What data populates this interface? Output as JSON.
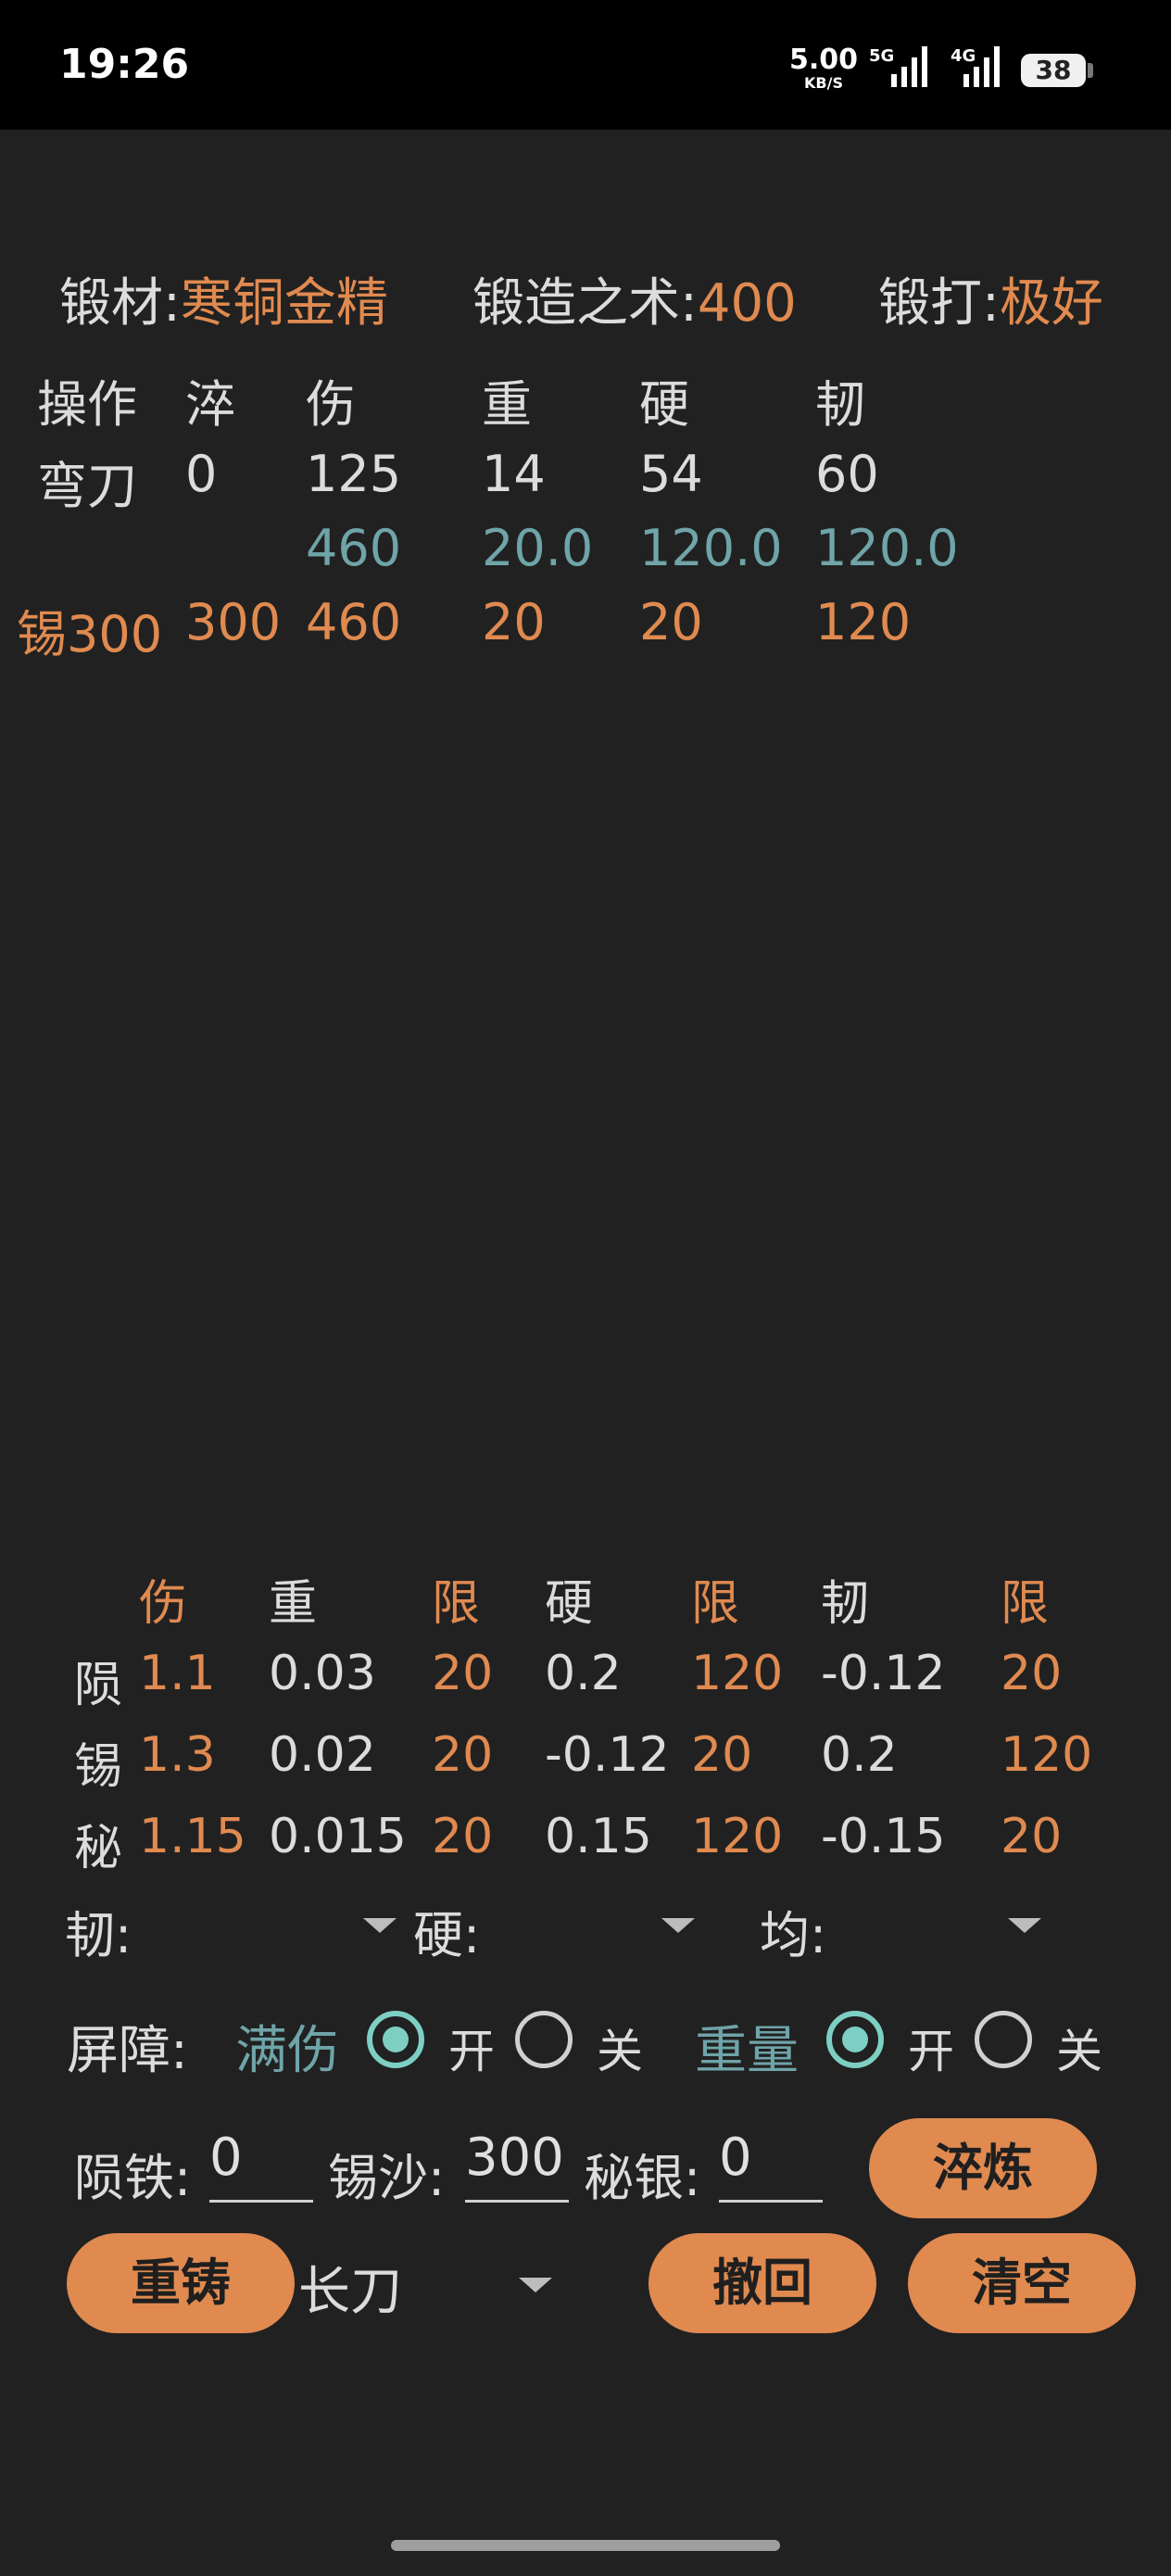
{
  "status_bar": {
    "time": "19:26",
    "net_speed": "5.00",
    "net_unit": "KB/S",
    "sig1_label": "5G",
    "sig2_label": "4G",
    "battery": "38"
  },
  "forge_info": {
    "material_label": "锻材:",
    "material_value": "寒铜金精",
    "skill_label": "锻造之术:",
    "skill_value": "400",
    "strike_label": "锻打:",
    "strike_value": "极好"
  },
  "stats_table": {
    "headers": [
      "操作",
      "淬",
      "伤",
      "重",
      "硬",
      "韧"
    ],
    "row1": [
      "弯刀",
      "0",
      "125",
      "14",
      "54",
      "60"
    ],
    "row2": [
      "460",
      "20.0",
      "120.0",
      "120.0"
    ],
    "row3": [
      "锡300",
      "300",
      "460",
      "20",
      "20",
      "120"
    ]
  },
  "coef_table": {
    "headers": [
      "伤",
      "重",
      "限",
      "硬",
      "限",
      "韧",
      "限"
    ],
    "rows": [
      {
        "name": "陨",
        "values": [
          "1.1",
          "0.03",
          "20",
          "0.2",
          "120",
          "-0.12",
          "20"
        ]
      },
      {
        "name": "锡",
        "values": [
          "1.3",
          "0.02",
          "20",
          "-0.12",
          "20",
          "0.2",
          "120"
        ]
      },
      {
        "name": "秘",
        "values": [
          "1.15",
          "0.015",
          "20",
          "0.15",
          "120",
          "-0.15",
          "20"
        ]
      }
    ]
  },
  "selectors": {
    "toughness_label": "韧:",
    "hardness_label": "硬:",
    "balance_label": "均:"
  },
  "barrier": {
    "label": "屏障:",
    "full_damage_label": "满伤",
    "on_label": "开",
    "off_label": "关",
    "weight_label": "重量"
  },
  "inputs": {
    "meteor_label": "陨铁:",
    "meteor_value": "0",
    "tin_label": "锡沙:",
    "tin_value": "300",
    "silver_label": "秘银:",
    "silver_value": "0"
  },
  "buttons": {
    "quench": "淬炼",
    "recast": "重铸",
    "undo": "撤回",
    "clear": "清空"
  },
  "weapon_select": "长刀",
  "colors": {
    "accent": "#e08a50",
    "teal": "#6fa4a8",
    "radio": "#7dcfc3",
    "background": "#212121"
  }
}
